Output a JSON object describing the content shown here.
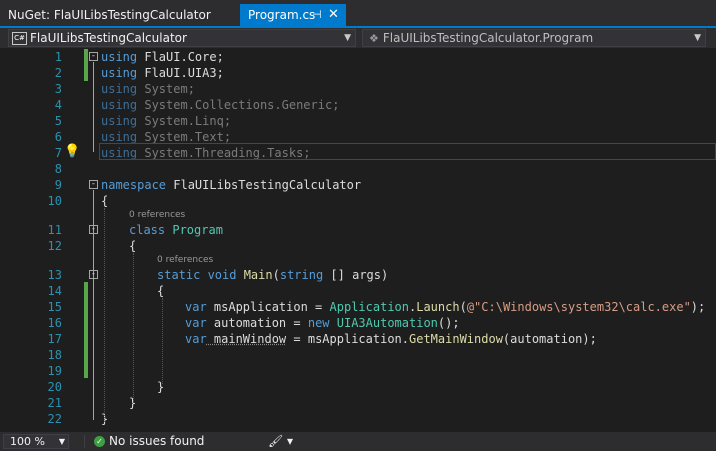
{
  "tabs": [
    {
      "label": "NuGet: FlaUILibsTestingCalculator",
      "active": false
    },
    {
      "label": "Program.cs",
      "active": true
    }
  ],
  "tab_icons": {
    "pin": "pin-icon",
    "close": "close-icon"
  },
  "nav": {
    "project": "FlaUILibsTestingCalculator",
    "scope": "FlaUILibsTestingCalculator.Program",
    "cs_badge": "C#"
  },
  "code": {
    "line_numbers": [
      "1",
      "2",
      "3",
      "4",
      "5",
      "6",
      "7",
      "8",
      "9",
      "10",
      "11",
      "12",
      "13",
      "14",
      "15",
      "16",
      "17",
      "18",
      "19",
      "20",
      "21",
      "22"
    ],
    "lines": [
      {
        "segments": [
          [
            "kw",
            "using"
          ],
          [
            "",
            "FlaUI.Core;"
          ]
        ]
      },
      {
        "segments": [
          [
            "kw",
            "using"
          ],
          [
            "",
            "FlaUI.UIA3;"
          ]
        ]
      },
      {
        "segments": [
          [
            "dimkw",
            "using"
          ],
          [
            "dim",
            "System;"
          ]
        ]
      },
      {
        "segments": [
          [
            "dimkw",
            "using"
          ],
          [
            "dim",
            "System.Collections.Generic;"
          ]
        ]
      },
      {
        "segments": [
          [
            "dimkw",
            "using"
          ],
          [
            "dim",
            "System.Linq;"
          ]
        ]
      },
      {
        "segments": [
          [
            "dimkw",
            "using"
          ],
          [
            "dim",
            "System.Text;"
          ]
        ]
      },
      {
        "segments": [
          [
            "dimkw",
            "using"
          ],
          [
            "dim",
            "System.Threading.Tasks;"
          ]
        ]
      },
      {
        "segments": []
      },
      {
        "segments": [
          [
            "kw",
            "namespace"
          ],
          [
            "",
            "FlaUILibsTestingCalculator"
          ]
        ]
      },
      {
        "segments": [
          [
            "",
            "{"
          ]
        ]
      },
      {
        "segments": [
          [
            "kw",
            "class"
          ],
          [
            "ty",
            "Program"
          ]
        ]
      },
      {
        "segments": [
          [
            "",
            "{"
          ]
        ]
      },
      {
        "segments": [
          [
            "kw",
            "static void"
          ],
          [
            "fn",
            "Main"
          ],
          [
            "",
            "("
          ],
          [
            "kw",
            "string"
          ],
          [
            "",
            "[] args)"
          ]
        ]
      },
      {
        "segments": [
          [
            "",
            "{"
          ]
        ]
      },
      {
        "segments": [
          [
            "kw",
            "var"
          ],
          [
            "",
            "msApplication = "
          ],
          [
            "ty",
            "Application"
          ],
          [
            "",
            "."
          ],
          [
            "fn",
            "Launch"
          ],
          [
            "",
            "("
          ],
          [
            "st",
            "@\"C:\\Windows\\system32\\calc.exe\""
          ],
          [
            "",
            ");"
          ]
        ]
      },
      {
        "segments": [
          [
            "kw",
            "var"
          ],
          [
            "",
            "automation = "
          ],
          [
            "kw",
            "new"
          ],
          [
            "ty",
            "UIA3Automation"
          ],
          [
            "",
            "();"
          ]
        ]
      },
      {
        "segments": [
          [
            "kw",
            "var"
          ],
          [
            "squig",
            "mainWindow"
          ],
          [
            "",
            "= msApplication."
          ],
          [
            "fn",
            "GetMainWindow"
          ],
          [
            "",
            "(automation);"
          ]
        ]
      },
      {
        "segments": []
      },
      {
        "segments": []
      },
      {
        "segments": [
          [
            "",
            "}"
          ]
        ]
      },
      {
        "segments": [
          [
            "",
            "}"
          ]
        ]
      },
      {
        "segments": [
          [
            "",
            "}"
          ]
        ]
      }
    ],
    "code_lens": [
      "0 references",
      "0 references"
    ]
  },
  "status": {
    "zoom": "100 %",
    "issues": "No issues found"
  }
}
